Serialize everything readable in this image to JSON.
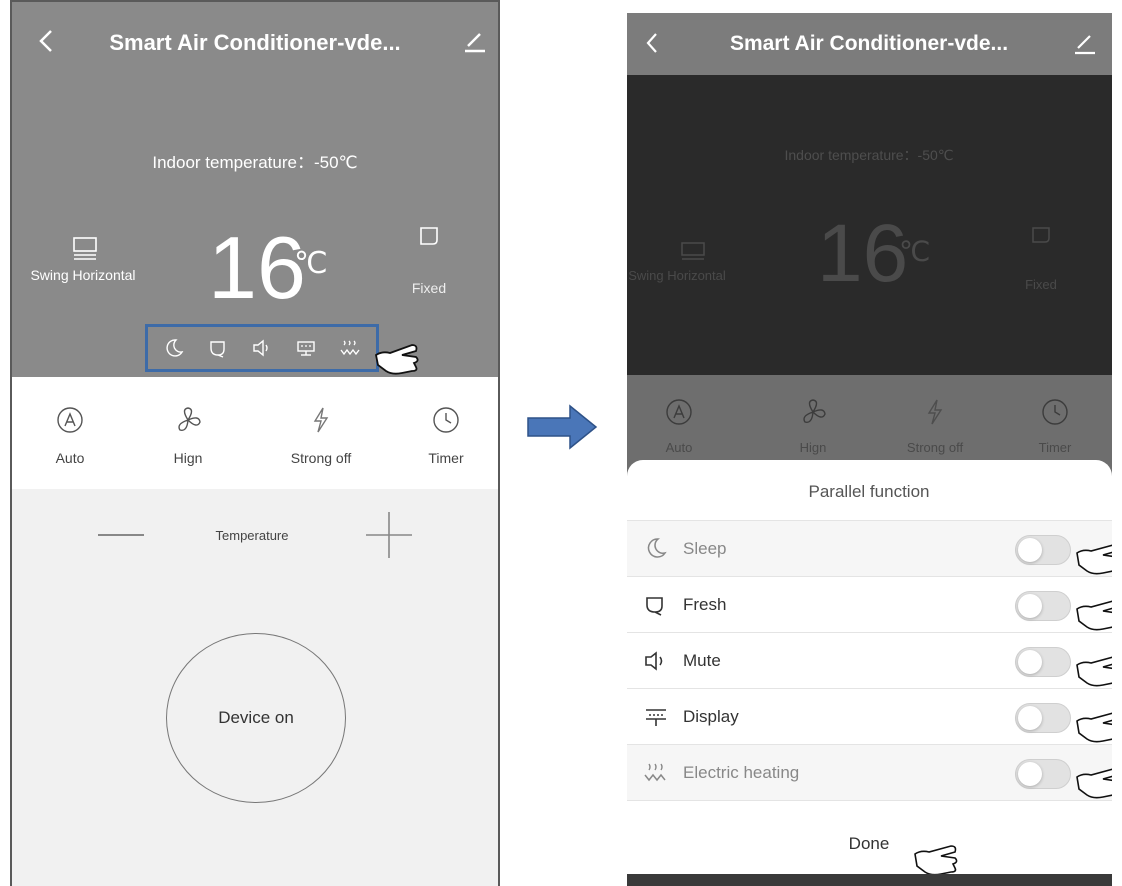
{
  "left_screen": {
    "header": {
      "title": "Smart Air Conditioner-vde..."
    },
    "indoor_temperature": "Indoor temperature：-50℃",
    "set_temperature": {
      "value": "16",
      "unit": "℃"
    },
    "swing": {
      "label": "Swing Horizontal"
    },
    "fixed": {
      "label": "Fixed"
    },
    "modes": [
      {
        "label": "Auto"
      },
      {
        "label": "Hign"
      },
      {
        "label": "Strong off"
      },
      {
        "label": "Timer"
      }
    ],
    "temperature_control": {
      "label": "Temperature"
    },
    "power_button": {
      "label": "Device on"
    }
  },
  "right_screen": {
    "header": {
      "title": "Smart Air Conditioner-vde..."
    },
    "indoor_temperature": "Indoor temperature：-50℃",
    "set_temperature": {
      "value": "16",
      "unit": "℃"
    },
    "swing": {
      "label": "Swing Horizontal"
    },
    "fixed": {
      "label": "Fixed"
    },
    "modes": [
      {
        "label": "Auto"
      },
      {
        "label": "Hign"
      },
      {
        "label": "Strong off"
      },
      {
        "label": "Timer"
      }
    ],
    "sheet": {
      "title": "Parallel function",
      "items": [
        {
          "label": "Sleep",
          "icon": "moon-icon",
          "enabled": false
        },
        {
          "label": "Fresh",
          "icon": "leaf-icon",
          "enabled": false
        },
        {
          "label": "Mute",
          "icon": "speaker-icon",
          "enabled": false
        },
        {
          "label": "Display",
          "icon": "display-icon",
          "enabled": false
        },
        {
          "label": "Electric heating",
          "icon": "heating-icon",
          "enabled": false
        }
      ],
      "done_label": "Done"
    }
  },
  "colors": {
    "highlight_box": "#3d6ba8",
    "arrow": "#4a76b8",
    "header_gray": "#8a8a8a"
  }
}
